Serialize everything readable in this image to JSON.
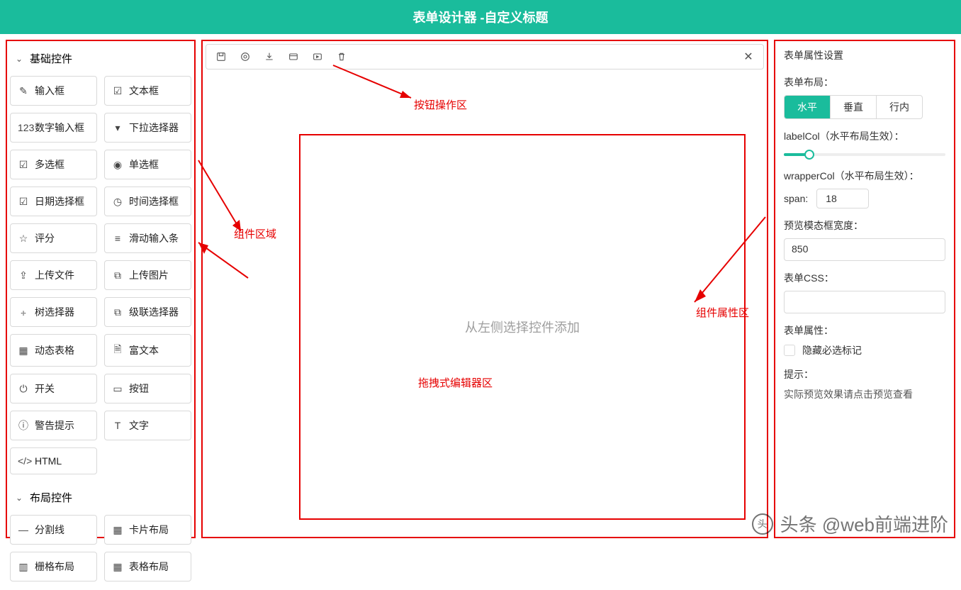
{
  "header": {
    "title": "表单设计器 -自定义标题"
  },
  "sidebar": {
    "sections": [
      {
        "title": "基础控件",
        "items": [
          {
            "icon": "✎",
            "name": "input",
            "label": "输入框"
          },
          {
            "icon": "☑",
            "name": "textarea",
            "label": "文本框"
          },
          {
            "icon": "123",
            "name": "number",
            "label": "数字输入框"
          },
          {
            "icon": "▾",
            "name": "select",
            "label": "下拉选择器"
          },
          {
            "icon": "☑",
            "name": "checkbox",
            "label": "多选框"
          },
          {
            "icon": "◉",
            "name": "radio",
            "label": "单选框"
          },
          {
            "icon": "☑",
            "name": "datepicker",
            "label": "日期选择框"
          },
          {
            "icon": "◷",
            "name": "timepicker",
            "label": "时间选择框"
          },
          {
            "icon": "☆",
            "name": "rate",
            "label": "评分"
          },
          {
            "icon": "≡",
            "name": "slider",
            "label": "滑动输入条"
          },
          {
            "icon": "⇪",
            "name": "upload-file",
            "label": "上传文件"
          },
          {
            "icon": "⧉",
            "name": "upload-image",
            "label": "上传图片"
          },
          {
            "icon": "⧾",
            "name": "tree-select",
            "label": "树选择器"
          },
          {
            "icon": "⧉",
            "name": "cascader",
            "label": "级联选择器"
          },
          {
            "icon": "▦",
            "name": "dyn-table",
            "label": "动态表格"
          },
          {
            "icon": "🗎",
            "name": "richtext",
            "label": "富文本"
          },
          {
            "icon": "⏻",
            "name": "switch",
            "label": "开关"
          },
          {
            "icon": "▭",
            "name": "button",
            "label": "按钮"
          },
          {
            "icon": "ⓘ",
            "name": "alert",
            "label": "警告提示"
          },
          {
            "icon": "T",
            "name": "text",
            "label": "文字"
          },
          {
            "icon": "</>",
            "name": "html",
            "label": "HTML"
          }
        ]
      },
      {
        "title": "布局控件",
        "items": [
          {
            "icon": "—",
            "name": "divider",
            "label": "分割线"
          },
          {
            "icon": "▦",
            "name": "card",
            "label": "卡片布局"
          },
          {
            "icon": "▥",
            "name": "grid",
            "label": "栅格布局"
          },
          {
            "icon": "▦",
            "name": "table-layout",
            "label": "表格布局"
          }
        ]
      }
    ]
  },
  "toolbar": {
    "buttons": [
      "save",
      "preview",
      "export",
      "code",
      "run",
      "delete"
    ],
    "close": "✕"
  },
  "editor": {
    "placeholder": "从左侧选择控件添加"
  },
  "annotations": {
    "toolbar_area": "按钮操作区",
    "component_area": "组件区域",
    "editor_area": "拖拽式编辑器区",
    "property_area": "组件属性区"
  },
  "props": {
    "title": "表单属性设置",
    "layout": {
      "label": "表单布局：",
      "options": [
        "水平",
        "垂直",
        "行内"
      ],
      "active": 0
    },
    "labelCol": {
      "label": "labelCol（水平布局生效）：",
      "value": 4,
      "max": 24
    },
    "wrapperCol": {
      "label": "wrapperCol（水平布局生效）：",
      "span_label": "span:",
      "value": "18"
    },
    "previewWidth": {
      "label": "预览模态框宽度：",
      "value": "850"
    },
    "css": {
      "label": "表单CSS：",
      "value": ""
    },
    "attrs": {
      "label": "表单属性：",
      "hide_required": "隐藏必选标记"
    },
    "tip": {
      "label": "提示：",
      "text": "实际预览效果请点击预览查看"
    }
  },
  "watermark": "头条  @web前端进阶"
}
